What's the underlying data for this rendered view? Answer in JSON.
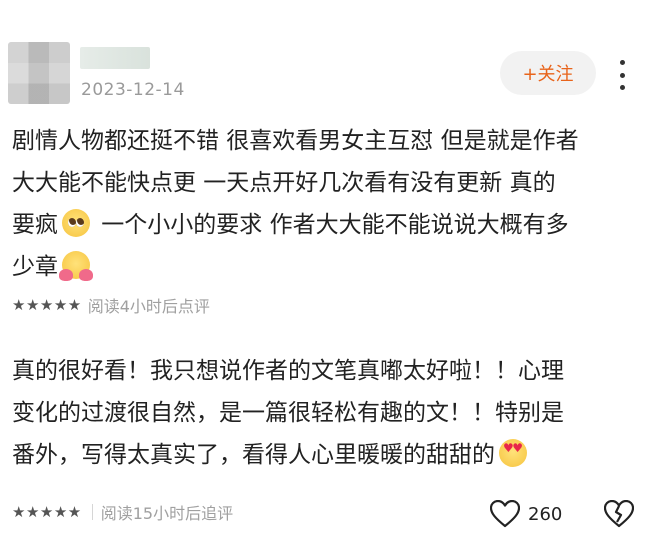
{
  "header": {
    "date": "2023-12-14",
    "follow_label": "+关注"
  },
  "reviews": [
    {
      "lines": [
        "剧情人物都还挺不错 很喜欢看男女主互怼 但是就是作者",
        "大大能不能快点更 一天点开好几次看有没有更新  真的",
        "要疯",
        " 一个小小的要求 作者大大能不能说说大概有多",
        "少章"
      ],
      "emojis": [
        "pleading-face",
        "hugging-face"
      ],
      "stars": "★★★★★",
      "meta": "阅读4小时后点评"
    },
    {
      "lines": [
        "真的很好看！我只想说作者的文笔真嘟太好啦！！心理",
        "变化的过渡很自然，是一篇很轻松有趣的文！！特别是",
        "番外，写得太真实了，看得人心里暖暖的甜甜的"
      ],
      "emojis": [
        "heart-eyes-face"
      ],
      "stars": "★★★★★",
      "meta": "阅读15小时后追评"
    }
  ],
  "actions": {
    "like_count": "260"
  },
  "colors": {
    "accent": "#e8641b",
    "meta_text": "#a0a0a0"
  }
}
